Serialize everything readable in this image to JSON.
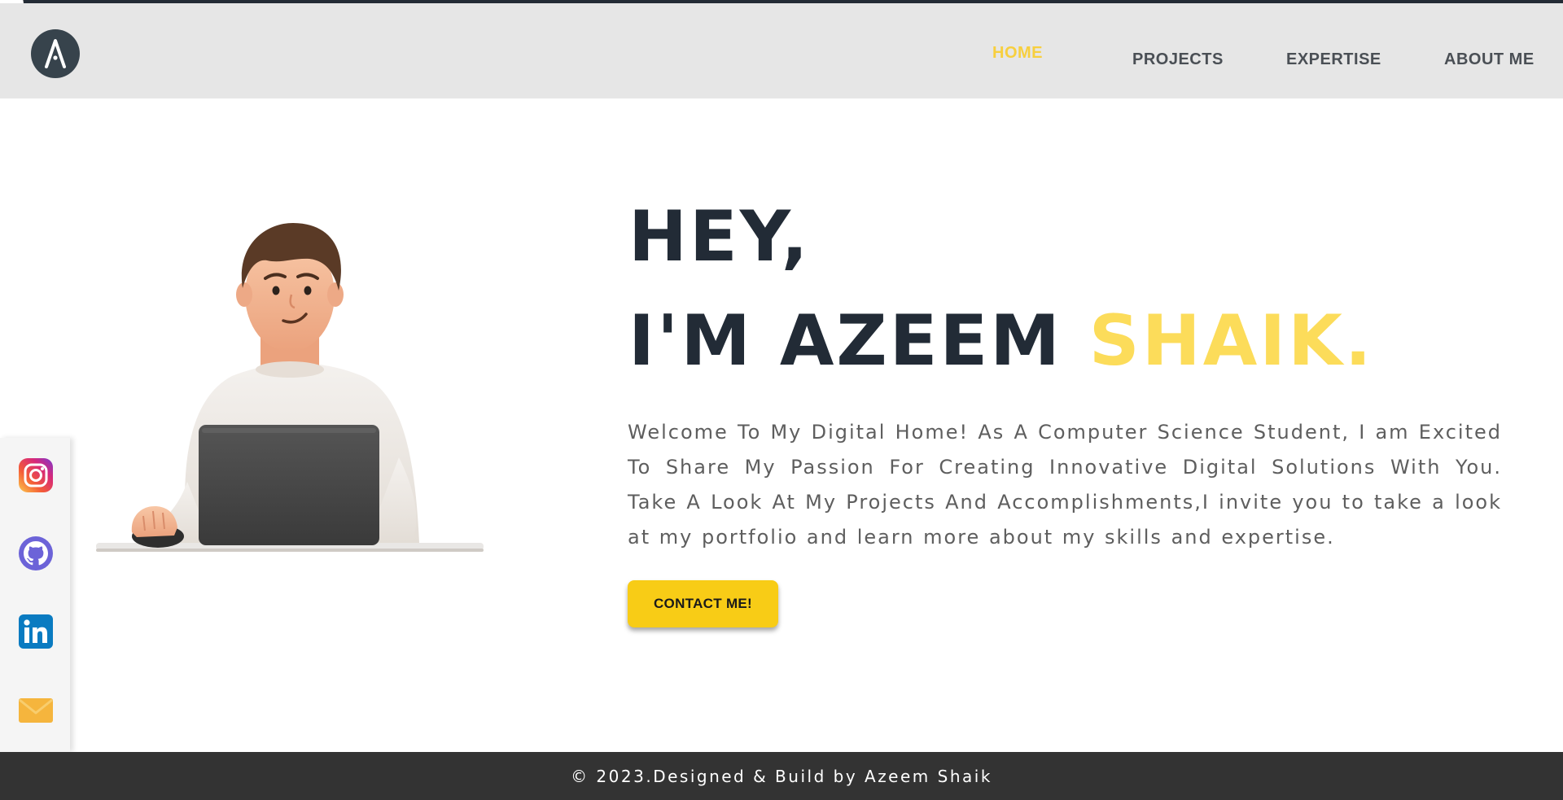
{
  "nav": {
    "logo_letter": "A",
    "items": [
      {
        "label": "HOME",
        "active": true
      },
      {
        "label": "PROJECTS",
        "active": false
      },
      {
        "label": "EXPERTISE",
        "active": false
      },
      {
        "label": "ABOUT ME",
        "active": false
      }
    ]
  },
  "hero": {
    "greeting": "HEY,",
    "name_prefix": "I'M AZEEM ",
    "name_accent": "SHAIK.",
    "intro": "Welcome To My Digital Home! As A Computer Science Student, I am Excited To Share My Passion For Creating Innovative Digital Solutions With You. Take A Look At My Projects And Accomplishments,I invite you to take a look at my portfolio and learn more about my skills and expertise.",
    "contact_label": "CONTACT ME!"
  },
  "social": [
    {
      "name": "instagram-icon"
    },
    {
      "name": "github-icon"
    },
    {
      "name": "linkedin-icon"
    },
    {
      "name": "mail-icon"
    }
  ],
  "footer": {
    "text": "© 2023.Designed & Build by Azeem Shaik"
  },
  "colors": {
    "accent": "#fcdc5a",
    "button": "#f8cc16",
    "heading": "#222b36",
    "nav_bg": "#e6e6e6",
    "footer_bg": "#333333"
  }
}
